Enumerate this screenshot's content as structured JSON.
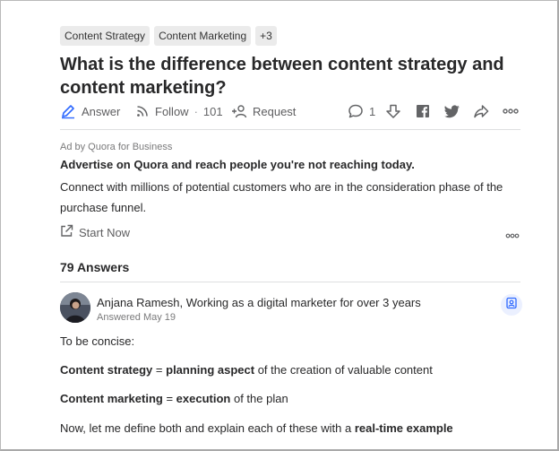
{
  "question": {
    "tags": [
      "Content Strategy",
      "Content Marketing",
      "+3"
    ],
    "title": "What is the difference between content strategy and content marketing?"
  },
  "actions": {
    "answer_label": "Answer",
    "follow_label": "Follow",
    "follow_sep": "·",
    "follow_count": "101",
    "request_label": "Request",
    "comment_count": "1"
  },
  "ad": {
    "label": "Ad by Quora for Business",
    "headline": "Advertise on Quora and reach people you're not reaching today.",
    "body": "Connect with millions of potential customers who are in the consideration phase of the purchase funnel.",
    "cta_label": "Start Now"
  },
  "answers": {
    "count_label": "79 Answers",
    "first": {
      "author": "Anjana Ramesh, Working as a digital marketer for over 3 years",
      "answered": "Answered May 19",
      "p1": "To be concise:",
      "p2_bold": "Content strategy",
      "p2_eq": " = ",
      "p2_bold2": "planning aspect",
      "p2_rest": " of the creation of valuable content",
      "p3_bold": "Content marketing",
      "p3_eq": " = ",
      "p3_bold2": "execution",
      "p3_rest": " of the plan",
      "p4_text": "Now, let me define both and explain each of these with a ",
      "p4_bold": "real-time example"
    }
  },
  "colors": {
    "accent_blue": "#2e69ff",
    "text": "#282829",
    "muted": "#636466",
    "divider": "#dedfe0"
  },
  "icons": [
    "answer-pencil-icon",
    "follow-rss-icon",
    "request-person-icon",
    "comment-icon",
    "downvote-icon",
    "facebook-icon",
    "twitter-icon",
    "share-icon",
    "more-icon",
    "external-link-icon",
    "bookmark-icon"
  ]
}
